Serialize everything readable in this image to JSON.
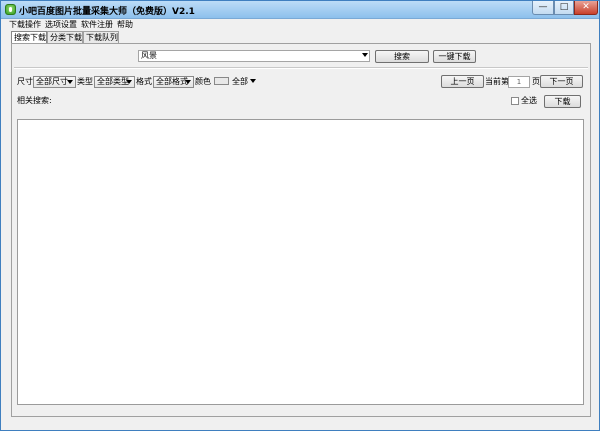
{
  "window": {
    "title": "小吧百度图片批量采集大师（免费版）V2.1",
    "min_label": "—",
    "max_label": "□",
    "close_label": "✕"
  },
  "menu": [
    "下载操作",
    "选项设置",
    "软件注册",
    "帮助"
  ],
  "tabs": [
    {
      "label": "搜索下载",
      "active": true
    },
    {
      "label": "分类下载",
      "active": false
    },
    {
      "label": "下载队列",
      "active": false
    }
  ],
  "search": {
    "keyword": "风景",
    "search_button": "搜索",
    "download_all_button": "一键下载"
  },
  "filters": {
    "size_label": "尺寸",
    "size_value": "全部尺寸",
    "type_label": "类型",
    "type_value": "全部类型",
    "format_label": "格式",
    "format_value": "全部格式",
    "color_label": "颜色",
    "color_value": "全部"
  },
  "pagination": {
    "prev_button": "上一页",
    "current_prefix": "当前第",
    "page": "1",
    "page_suffix": "页",
    "next_button": "下一页"
  },
  "related": {
    "label": "相关搜索:",
    "select_all_label": "全选",
    "download_button": "下载"
  }
}
